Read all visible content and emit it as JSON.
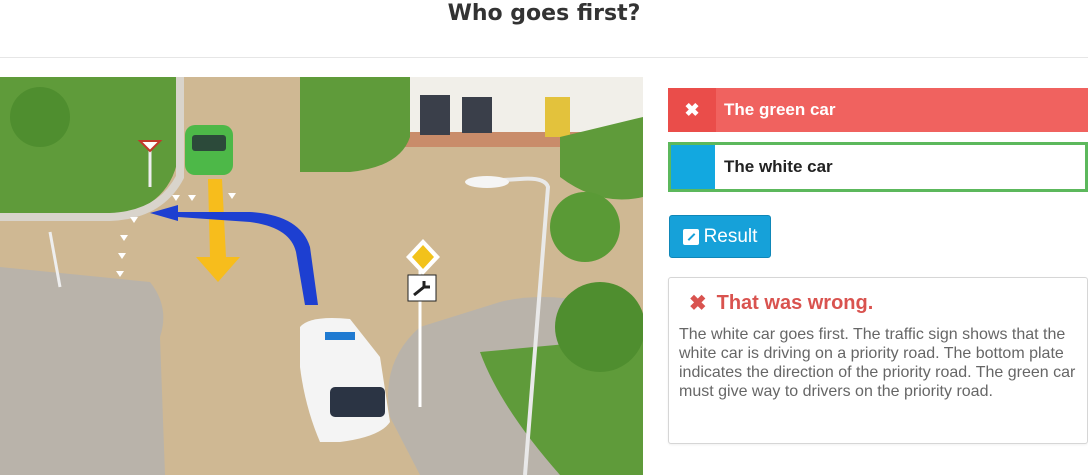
{
  "title": "Who goes first?",
  "answers": [
    {
      "label": "The green car",
      "state": "wrong",
      "icon": "x-icon"
    },
    {
      "label": "The white car",
      "state": "correct",
      "icon": "blue-marker"
    }
  ],
  "result_button": {
    "label": "Result",
    "icon": "external-link-icon"
  },
  "feedback": {
    "icon": "x-icon",
    "title": "That was wrong.",
    "text": "The white car goes first. The traffic sign shows that the white car is driving on a priority road. The bottom plate indicates the direction of the priority road. The green car must give way to drivers on the priority road."
  },
  "colors": {
    "wrong_bg": "#f0625f",
    "correct_border": "#5cb85c",
    "correct_marker": "#12a8e0",
    "button": "#16a1d9",
    "wrong_text": "#d9534f"
  },
  "image": {
    "content": "intersection-scene",
    "sign_plate_icon": "priority-road-direction-sign",
    "arrows": [
      "yellow-straight-arrow",
      "blue-left-turn-arrow"
    ]
  }
}
